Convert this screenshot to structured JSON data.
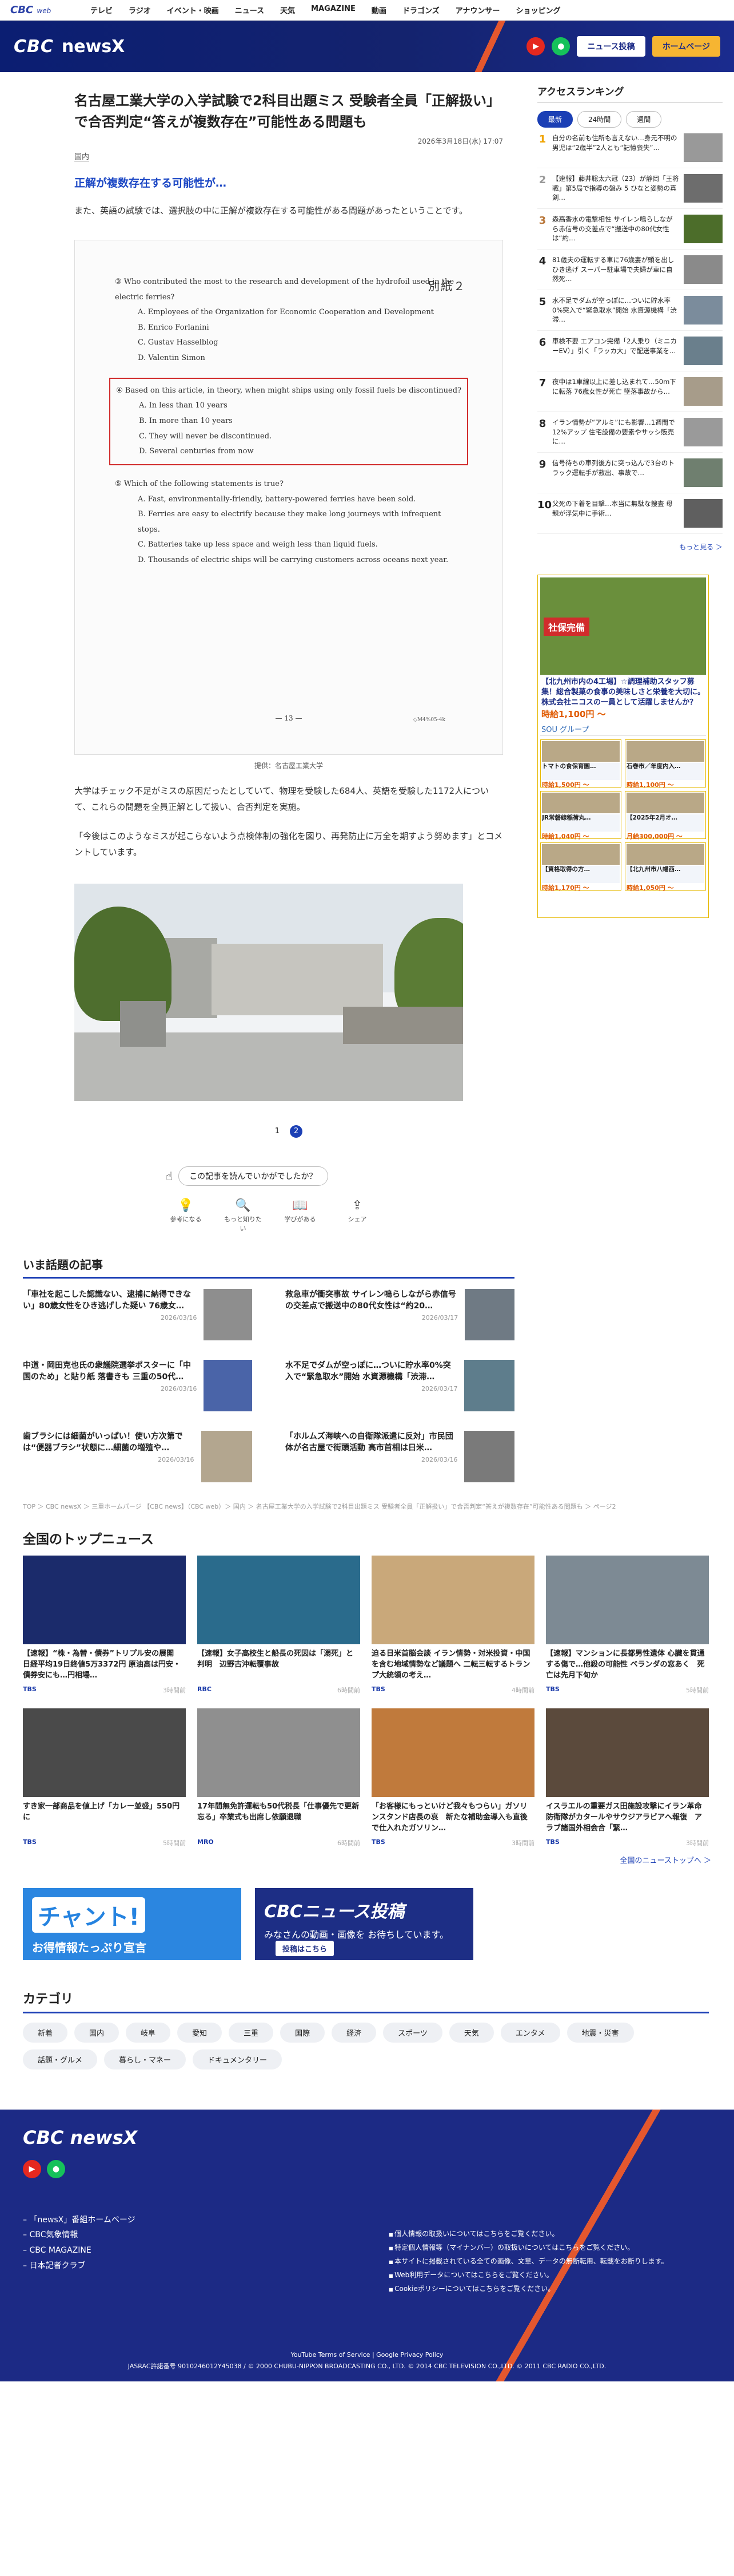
{
  "topnav": {
    "logo": "CBC",
    "logo_sub": "web",
    "items": [
      "テレビ",
      "ラジオ",
      "イベント・映画",
      "ニュース",
      "天気",
      "MAGAZINE",
      "動画",
      "ドラゴンズ",
      "アナウンサー",
      "ショッピング"
    ]
  },
  "header": {
    "brand_cbc": "CBC",
    "brand_name": "newsX",
    "post_btn": "ニュース投稿",
    "home_btn": "ホームページ",
    "youtube_icon": "youtube-icon",
    "line_icon": "line-icon"
  },
  "article": {
    "title": "名古屋工業大学の入学試験で2科目出題ミス 受験者全員「正解扱い」で合否判定“答えが複数存在”可能性ある問題も",
    "date": "2026年3月18日(水) 17:07",
    "category": "国内",
    "subhead": "正解が複数存在する可能性が…",
    "p1": "また、英語の試験では、選択肢の中に正解が複数存在する可能性がある問題があったということです。",
    "paper": {
      "tag": "別紙２",
      "q1": "③ Who contributed the most to the research and development of the hydrofoil used in the electric ferries?",
      "q1_opts": [
        "A. Employees of the Organization for Economic Cooperation and Development",
        "B. Enrico Forlanini",
        "C. Gustav Hasselblog",
        "D. Valentin Simon"
      ],
      "q2": "④ Based on this article, in theory, when might ships using only fossil fuels be discontinued?",
      "q2_opts": [
        "A. In less than 10 years",
        "B. In more than 10 years",
        "C. They will never be discontinued.",
        "D. Several centuries from now"
      ],
      "q3": "⑤ Which of the following statements is true?",
      "q3_opts": [
        "A. Fast, environmentally-friendly, battery-powered ferries have been sold.",
        "B. Ferries are easy to electrify because they make long journeys with infrequent stops.",
        "C. Batteries take up less space and weigh less than liquid fuels.",
        "D. Thousands of electric ships will be carrying customers across oceans next year."
      ],
      "page": "— 13 —",
      "code": "◇M4%05-4k"
    },
    "caption": "提供：名古屋工業大学",
    "p2": "大学はチェック不足がミスの原因だったとしていて、物理を受験した684人、英語を受験した1172人について、これらの問題を全員正解として扱い、合否判定を実施。",
    "p3": "「今後はこのようなミスが起こらないよう点検体制の強化を図り、再発防止に万全を期すよう努めます」とコメントしています。",
    "pages": [
      "1",
      "2"
    ],
    "survey": "この記事を読んでいかがでしたか？",
    "reactions": [
      "参考になる",
      "もっと知りたい",
      "学びがある",
      "シェア"
    ]
  },
  "hot": {
    "title": "いま話題の記事",
    "items": [
      {
        "t": "「車社を起こした認識ない、逮捕に納得できない」80歳女性をひき逃げした疑い 76歳女…",
        "d": "2026/03/16"
      },
      {
        "t": "救急車が衝突事故 サイレン鳴らしながら赤信号の交差点で搬送中の80代女性は“約20…",
        "d": "2026/03/17"
      },
      {
        "t": "中道・岡田克也氏の衆議院選挙ポスターに「中国のため」と貼り紙 落書きも 三重の50代…",
        "d": "2026/03/16"
      },
      {
        "t": "水不足でダムが空っぽに…ついに貯水率0%突入で“緊急取水”開始 水資源機構「渋滞…",
        "d": "2026/03/17"
      },
      {
        "t": "歯ブラシには細菌がいっぱい！使い方次第では“便器ブラシ”状態に…細菌の増殖や…",
        "d": "2026/03/16"
      },
      {
        "t": "「ホルムズ海峡への自衛隊派遣に反対」市民団体が名古屋で街頭活動 高市首相は日米…",
        "d": "2026/03/16"
      }
    ]
  },
  "breadcrumb": "TOP ＞ CBC newsX ＞ 三重ホームパージ 【CBC news】（CBC web）＞ 国内 ＞ 名古屋工業大学の入学試験で2科目出題ミス 受験者全員「正解扱い」で合否判定“答えが複数存在”可能性ある問題も ＞ ページ2",
  "top": {
    "title": "全国のトップニュース",
    "items": [
      {
        "t": "【速報】“株・為替・債券”トリプル安の展開　日経平均19日終値5万3372円 原油高は円安・債券安にも…円相場…",
        "s": "TBS",
        "d": "3時間前"
      },
      {
        "t": "【速報】女子高校生と船長の死因は「溺死」と判明　辺野古沖転覆事故",
        "s": "RBC",
        "d": "6時間前"
      },
      {
        "t": "迫る日米首脳会談 イラン情勢・対米投資・中国を含む地域情勢など議題へ 二転三転するトランプ大統領の考え…",
        "s": "TBS",
        "d": "4時間前"
      },
      {
        "t": "【速報】マンションに長都男性遺体 心臓を貫通する傷で…他殺の可能性 ベランダの窓あく　死亡は先月下旬か",
        "s": "TBS",
        "d": "5時間前"
      },
      {
        "t": "すき家一部商品を値上げ「カレー並盛」550円に",
        "s": "TBS",
        "d": "5時間前"
      },
      {
        "t": "17年間無免許運転も50代税長「仕事優先で更新忘る」卒業式も出席し依願退職",
        "s": "MRO",
        "d": "6時間前"
      },
      {
        "t": "「お客様にもっといけど我々もつらい」ガソリンスタンド店長の哀　新たな補助金導入も直後で仕入れたガソリン…",
        "s": "TBS",
        "d": "3時間前"
      },
      {
        "t": "イスラエルの重要ガス田施設攻撃にイラン革命防衛隊がカタールやサウジアラビアへ報復　アラブ諸国外相会合「緊…",
        "s": "TBS",
        "d": "3時間前"
      }
    ]
  },
  "top_more": "全国のニューストップへ ＞",
  "banners": {
    "chant_big": "チャント!",
    "chant_sub": "お得情報たっぷり宣言",
    "post_big": "CBCニュース投稿",
    "post_sub": "みなさんの動画・画像を お待ちしています。",
    "post_btn": "投稿はこちら"
  },
  "categories": {
    "title": "カテゴリ",
    "items": [
      "新着",
      "国内",
      "岐阜",
      "愛知",
      "三重",
      "国際",
      "経済",
      "スポーツ",
      "天気",
      "エンタメ",
      "地震・災害",
      "話題・グルメ",
      "暮らし・マネー",
      "ドキュメンタリー"
    ]
  },
  "footer": {
    "brand": "CBC newsX",
    "links": [
      "「newsX」番組ホームページ",
      "CBC気象情報",
      "CBC MAGAZINE",
      "日本記者クラブ"
    ],
    "rlinks": [
      "個人情報の取扱いについてはこちらをご覧ください。",
      "特定個人情報等（マイナンバー）の取扱いについてはこちらをご覧ください。",
      "本サイトに掲載されている全ての画像、文章、データの無断転用、転載をお断りします。",
      "Web利用データについてはこちらをご覧ください。",
      "Cookieポリシーについてはこちらをご覧ください。"
    ],
    "legal1": "YouTube Terms of Service | Google Privacy Policy",
    "legal2": "JASRAC許諾番号 9010246012Y45038 / © 2000 CHUBU-NIPPON BROADCASTING CO., LTD. © 2014 CBC TELEVISION CO.,LTD. © 2011 CBC RADIO CO.,LTD."
  },
  "ranking": {
    "title": "アクセスランキング",
    "tabs": [
      "最新",
      "24時間",
      "週間"
    ],
    "items": [
      "自分の名前も住所も言えない…身元不明の男児は“2歳半”2人とも“記憶喪失”…",
      "【速報】藤井聡太六冠（23）が静岡「王将戦」第5局で指導の盤み 5 ひなと姿勢の真剣…",
      "森高香水の電撃相性 サイレン鳴らしながら赤信号の交差点で“搬送中の80代女性は“約…",
      "81歳夫の運転する車に76歳妻が頭を出しひき逃げ スーパー駐車場で夫婦が車に自然死…",
      "水不足でダムが空っぽに…ついに貯水率0%突入で“緊急取水”開始 水資源機構「渋滞…",
      "車検不要 エアコン完備「2人乗り（ミニカーEV）」引く「ラッカ大」で配送事業を…",
      "夜中は1車線以上に差し込まれて…50m下に転落 76歳女性が死亡 墜落事故から…",
      "イラン情勢が“アルミ”にも影響…1週間で12%アップ 住宅設備の要素やサッシ販売に…",
      "信号待ちの車列後方に突っ込んで3台のトラック運転手が救出、事故で…",
      "父死の下着を目撃…本当に無駄な捜査 母親が浮気中に手術…"
    ],
    "more": "もっと見る ＞"
  },
  "ad": {
    "hero_label": "社保完備",
    "hero_title": "【北九州市内の4工場】☆調理補助スタッフ募集！総合製菓の食事の美味しさと栄養を大切に。株式会社ニコスの一員として活躍しませんか？",
    "hero_price": "時給1,100円 ～",
    "sou": "SOU グループ",
    "cells": [
      {
        "t": "トマトの食保育園…",
        "p": "時給1,500円 ～"
      },
      {
        "t": "石巻市／年度内入…",
        "p": "時給1,100円 ～"
      },
      {
        "t": "JR常磐線稲荷丸…",
        "p": "時給1,040円 ～"
      },
      {
        "t": "【2025年2月オ…",
        "p": "月給300,000円 ～"
      },
      {
        "t": "【資格取得の方…",
        "p": "時給1,170円 ～"
      },
      {
        "t": "【北九州市八幡西…",
        "p": "時給1,050円 ～"
      }
    ]
  }
}
